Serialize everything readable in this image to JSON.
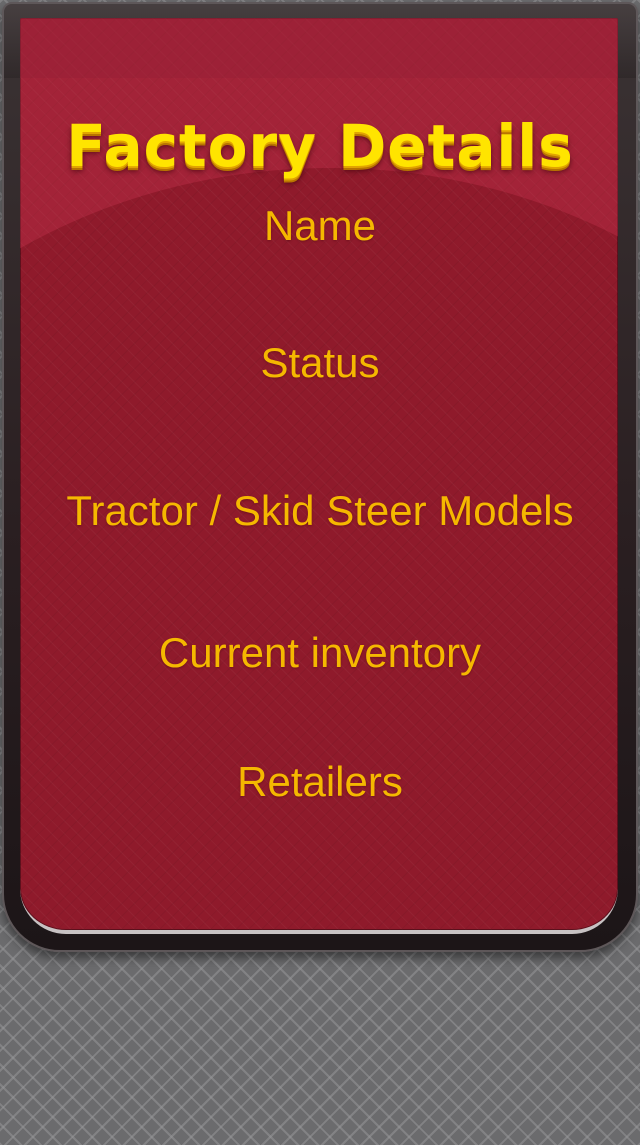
{
  "page": {
    "title": "Factory Details"
  },
  "menu": {
    "items": [
      {
        "label": "Name"
      },
      {
        "label": "Status"
      },
      {
        "label": "Tractor / Skid Steer Models"
      },
      {
        "label": "Current inventory"
      },
      {
        "label": "Retailers"
      }
    ]
  },
  "colors": {
    "panel": "#8f1a2b",
    "panel_highlight": "#b72a47",
    "title_text": "#ffe400",
    "menu_text": "#f5b800",
    "frame": "#2a1f21",
    "background": "#6b6b6d"
  }
}
